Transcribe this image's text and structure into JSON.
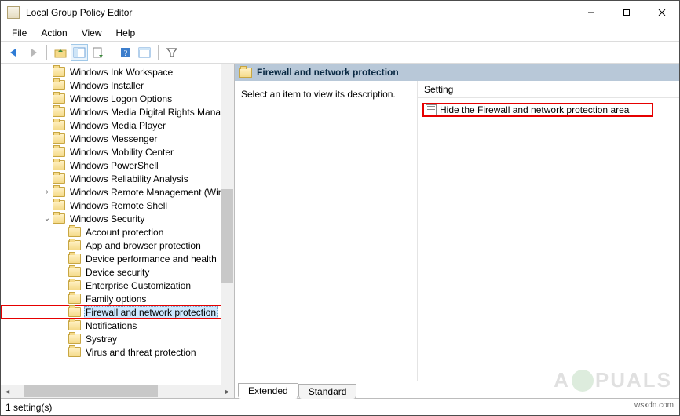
{
  "title": "Local Group Policy Editor",
  "menu": {
    "file": "File",
    "action": "Action",
    "view": "View",
    "help": "Help"
  },
  "tree": {
    "indentChild": 52,
    "indentGrand": 72,
    "items": [
      {
        "label": "Windows Ink Workspace",
        "level": 1,
        "expander": ""
      },
      {
        "label": "Windows Installer",
        "level": 1,
        "expander": ""
      },
      {
        "label": "Windows Logon Options",
        "level": 1,
        "expander": ""
      },
      {
        "label": "Windows Media Digital Rights Manag",
        "level": 1,
        "expander": ""
      },
      {
        "label": "Windows Media Player",
        "level": 1,
        "expander": ""
      },
      {
        "label": "Windows Messenger",
        "level": 1,
        "expander": ""
      },
      {
        "label": "Windows Mobility Center",
        "level": 1,
        "expander": ""
      },
      {
        "label": "Windows PowerShell",
        "level": 1,
        "expander": ""
      },
      {
        "label": "Windows Reliability Analysis",
        "level": 1,
        "expander": ""
      },
      {
        "label": "Windows Remote Management (Winl",
        "level": 1,
        "expander": ">"
      },
      {
        "label": "Windows Remote Shell",
        "level": 1,
        "expander": ""
      },
      {
        "label": "Windows Security",
        "level": 1,
        "expander": "v"
      },
      {
        "label": "Account protection",
        "level": 2,
        "expander": ""
      },
      {
        "label": "App and browser protection",
        "level": 2,
        "expander": ""
      },
      {
        "label": "Device performance and health",
        "level": 2,
        "expander": ""
      },
      {
        "label": "Device security",
        "level": 2,
        "expander": ""
      },
      {
        "label": "Enterprise Customization",
        "level": 2,
        "expander": ""
      },
      {
        "label": "Family options",
        "level": 2,
        "expander": ""
      },
      {
        "label": "Firewall and network protection",
        "level": 2,
        "expander": "",
        "selected": true,
        "highlighted": true
      },
      {
        "label": "Notifications",
        "level": 2,
        "expander": ""
      },
      {
        "label": "Systray",
        "level": 2,
        "expander": ""
      },
      {
        "label": "Virus and threat protection",
        "level": 2,
        "expander": ""
      }
    ]
  },
  "right": {
    "heading": "Firewall and network protection",
    "description": "Select an item to view its description.",
    "columnHeader": "Setting",
    "settings": [
      {
        "label": "Hide the Firewall and network protection area"
      }
    ],
    "tabs": {
      "extended": "Extended",
      "standard": "Standard"
    }
  },
  "status": "1 setting(s)",
  "watermark": {
    "pre": "A",
    "post": "PUALS"
  },
  "attribution": "wsxdn.com"
}
